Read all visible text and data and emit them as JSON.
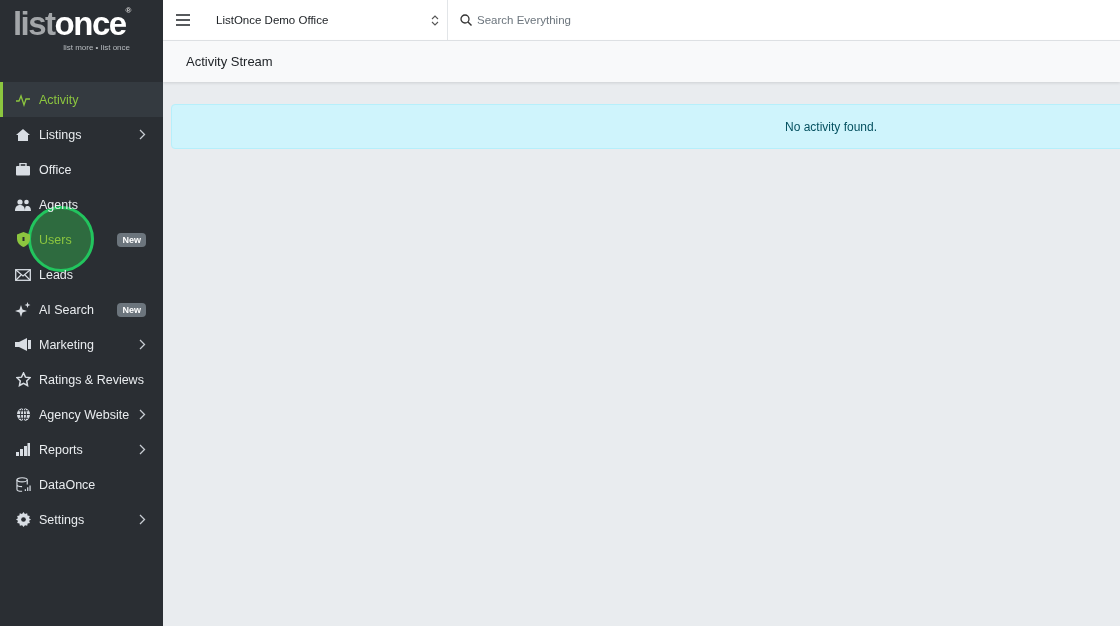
{
  "logo": {
    "word_start": "list",
    "word_end": "once",
    "tagline": "list more • list once",
    "mark": "®"
  },
  "sidebar": {
    "items": [
      {
        "label": "Activity",
        "selected": true,
        "has_submenu": false
      },
      {
        "label": "Listings",
        "selected": false,
        "has_submenu": true
      },
      {
        "label": "Office",
        "selected": false,
        "has_submenu": false
      },
      {
        "label": "Agents",
        "selected": false,
        "has_submenu": false
      },
      {
        "label": "Users",
        "selected": false,
        "has_submenu": false,
        "badge": "New",
        "clicked": true
      },
      {
        "label": "Leads",
        "selected": false,
        "has_submenu": false
      },
      {
        "label": "AI Search",
        "selected": false,
        "has_submenu": false,
        "badge": "New"
      },
      {
        "label": "Marketing",
        "selected": false,
        "has_submenu": true
      },
      {
        "label": "Ratings & Reviews",
        "selected": false,
        "has_submenu": false
      },
      {
        "label": "Agency Website",
        "selected": false,
        "has_submenu": true
      },
      {
        "label": "Reports",
        "selected": false,
        "has_submenu": true
      },
      {
        "label": "DataOnce",
        "selected": false,
        "has_submenu": false
      },
      {
        "label": "Settings",
        "selected": false,
        "has_submenu": true
      }
    ]
  },
  "topbar": {
    "office": "ListOnce Demo Office",
    "search": {
      "placeholder": "Search Everything"
    }
  },
  "page": {
    "title": "Activity Stream",
    "alert": "No activity found."
  }
}
